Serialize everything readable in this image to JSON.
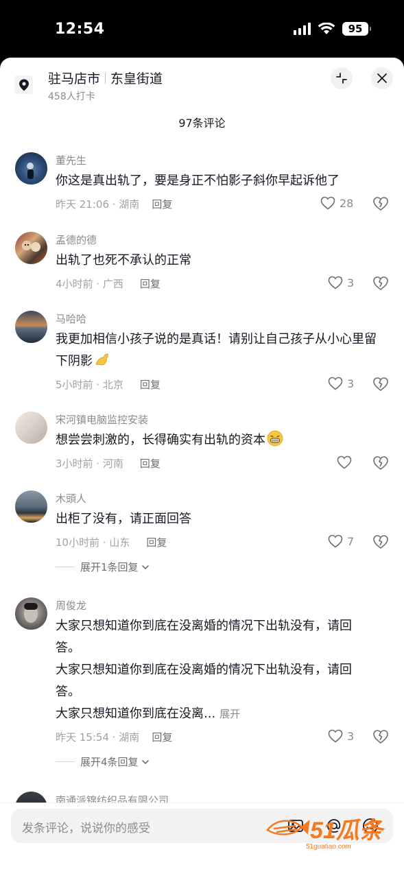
{
  "status_bar": {
    "time": "12:54",
    "battery": "95"
  },
  "location": {
    "city": "驻马店市",
    "street": "东皇街道",
    "checkins": "458人打卡"
  },
  "comment_count": "97条评论",
  "comments": [
    {
      "user": "董先生",
      "text": "你这是真出轨了，要是身正不怕影子斜你早起诉他了",
      "time": "昨天 21:06 · 湖南",
      "reply": "回复",
      "likes": "28"
    },
    {
      "user": "孟德的德",
      "text": "出轨了也死不承认的正常",
      "time": "4小时前 · 广西",
      "reply": "回复",
      "likes": "3"
    },
    {
      "user": "马哈哈",
      "text": "我更加相信小孩子说的是真话！请别让自己孩子从小心里留下阴影",
      "time": "5小时前 · 北京",
      "reply": "回复",
      "likes": "3"
    },
    {
      "user": "宋河镇电脑监控安装",
      "text": "想尝尝刺激的，长得确实有出轨的资本",
      "time": "3小时前 · 河南",
      "reply": "回复",
      "likes": ""
    },
    {
      "user": "木頭人",
      "text": "出柜了没有，请正面回答",
      "time": "10小时前 · 山东",
      "reply": "回复",
      "likes": "7",
      "expand": "展开1条回复"
    },
    {
      "user": "周俊龙",
      "text_lines": [
        "大家只想知道你到底在没离婚的情况下出轨没有，请回",
        "答。",
        "大家只想知道你到底在没离婚的情况下出轨没有，请回",
        "答。",
        "大家只想知道你到底在没离..."
      ],
      "more": "展开",
      "time": "昨天 15:54 · 湖南",
      "reply": "回复",
      "likes": "3",
      "expand": "展开4条回复"
    },
    {
      "user": "南通派锦纺织品有限公司"
    }
  ],
  "input": {
    "placeholder": "发条评论，说说你的感受"
  },
  "watermark": {
    "brand": "51瓜条",
    "url": "51guatiao.com",
    "color": "#f47a20"
  },
  "icons": [
    "location-pin-icon",
    "collapse-icon",
    "close-icon",
    "heart-icon",
    "broken-heart-icon",
    "chevron-down-icon",
    "at-icon",
    "emoji-icon"
  ]
}
